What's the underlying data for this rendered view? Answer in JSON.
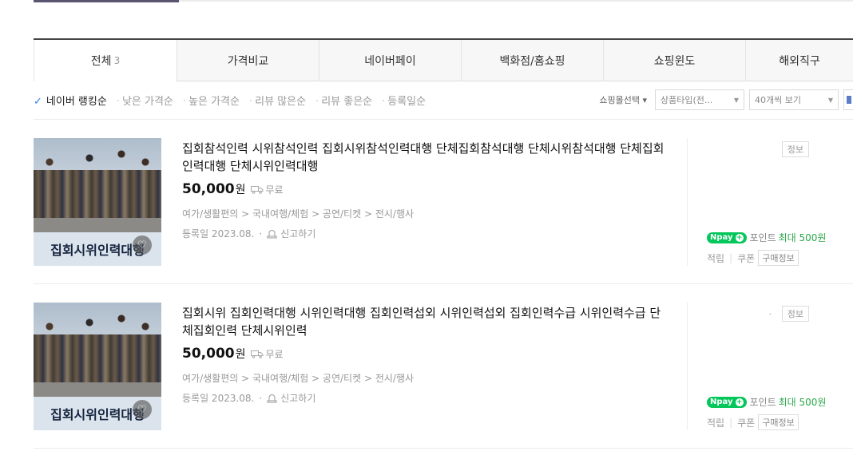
{
  "tabs": [
    {
      "label": "전체",
      "count": "3"
    },
    {
      "label": "가격비교"
    },
    {
      "label": "네이버페이"
    },
    {
      "label": "백화점/홈쇼핑"
    },
    {
      "label": "쇼핑윈도"
    },
    {
      "label": "해외직구"
    }
  ],
  "sort": {
    "active": "네이버 랭킹순",
    "options": [
      "낮은 가격순",
      "높은 가격순",
      "리뷰 많은순",
      "리뷰 좋은순",
      "등록일순"
    ]
  },
  "filters": {
    "mall_select": "쇼핑몰선택",
    "product_type": "상품타입(전...",
    "per_page": "40개씩 보기"
  },
  "products": [
    {
      "title": "집회참석인력 시위참석인력 집회시위참석인력대행 단체집회참석대행 단체시위참석대행 단체집회인력대행 단체시위인력대행",
      "price": "50,000",
      "currency": "원",
      "shipping": "무료",
      "category": "여가/생활편의 > 국내여행/체험 > 공연/티켓 > 전시/행사",
      "registered": "등록일 2023.08.",
      "report": "신고하기",
      "thumb_text": "집회시위인력대행",
      "info_label": "정보",
      "info_dot": "",
      "npay_label": "pay",
      "points_label": "포인트",
      "points_max": "최대 500원",
      "earn": "적립",
      "coupon": "쿠폰",
      "buy_info": "구매정보"
    },
    {
      "title": "집회시위 집회인력대행 시위인력대행 집회인력섭외 시위인력섭외 집회인력수급 시위인력수급 단체집회인력 단체시위인력",
      "price": "50,000",
      "currency": "원",
      "shipping": "무료",
      "category": "여가/생활편의 > 국내여행/체험 > 공연/티켓 > 전시/행사",
      "registered": "등록일 2023.08.",
      "report": "신고하기",
      "thumb_text": "집회시위인력대행",
      "info_label": "정보",
      "info_dot": "·",
      "npay_label": "pay",
      "points_label": "포인트",
      "points_max": "최대 500원",
      "earn": "적립",
      "coupon": "쿠폰",
      "buy_info": "구매정보"
    }
  ]
}
